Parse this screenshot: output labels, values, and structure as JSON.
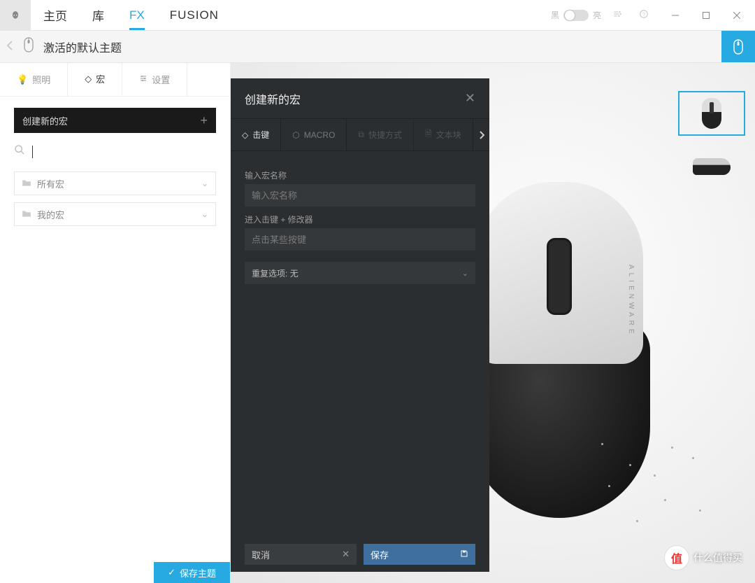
{
  "nav": {
    "tabs": [
      "主页",
      "库",
      "FX",
      "FUSION"
    ],
    "active_index": 2,
    "theme_dark_label": "黑",
    "theme_light_label": "亮"
  },
  "subheader": {
    "title": "激活的默认主题"
  },
  "sidebar": {
    "tabs": [
      {
        "icon": "bulb",
        "label": "照明"
      },
      {
        "icon": "diamond",
        "label": "宏"
      },
      {
        "icon": "sliders",
        "label": "设置"
      }
    ],
    "active_tab_index": 1,
    "create_label": "创建新的宏",
    "search_placeholder": "",
    "folders": [
      {
        "label": "所有宏"
      },
      {
        "label": "我的宏"
      }
    ],
    "save_theme_label": "保存主题"
  },
  "modal": {
    "title": "创建新的宏",
    "tabs": [
      {
        "icon": "diamond",
        "label": "击键",
        "enabled": true
      },
      {
        "icon": "macro",
        "label": "MACRO",
        "enabled": true
      },
      {
        "icon": "shortcut",
        "label": "快捷方式",
        "enabled": false
      },
      {
        "icon": "text",
        "label": "文本块",
        "enabled": false
      }
    ],
    "active_tab_index": 0,
    "name_label": "输入宏名称",
    "name_placeholder": "输入宏名称",
    "keys_label": "进入击键 + 修改器",
    "keys_placeholder": "点击某些按键",
    "repeat_label": "重复选项:",
    "repeat_value": "无",
    "cancel_label": "取消",
    "save_label": "保存"
  },
  "product": {
    "brand": "ALIENWARE"
  },
  "watermark": {
    "badge": "值",
    "text": "什么值得买"
  }
}
